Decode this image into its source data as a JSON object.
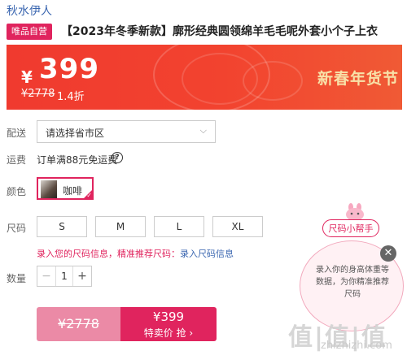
{
  "store_name": "秋水伊人",
  "badge": "唯品自营",
  "product_title": "【2023年冬季新款】廓形经典圆领绵羊毛毛呢外套小个子上衣",
  "banner": {
    "currency": "¥",
    "price": "399",
    "original_price": "¥2778",
    "discount": "1.4折",
    "promo_text": "新春年货节",
    "gradient_colors": [
      "#f03a2f",
      "#f05a35"
    ],
    "promo_color": "#f8e1a8"
  },
  "delivery": {
    "label": "配送",
    "value": "请选择省市区",
    "icon": "chevron-down-icon"
  },
  "shipping": {
    "label": "运费",
    "value": "订单满88元免运费",
    "icon": "question-icon"
  },
  "color": {
    "label": "颜色",
    "selected": "咖啡"
  },
  "size": {
    "label": "尺码",
    "options": [
      "S",
      "M",
      "L",
      "XL"
    ]
  },
  "size_entry": {
    "prompt": "录入您的尺码信息，精准推荐尺码：",
    "link": "录入尺码信息"
  },
  "quantity": {
    "label": "数量",
    "value": "1",
    "minus": "−",
    "plus": "+"
  },
  "buy": {
    "old_price": "¥2778",
    "price": "¥399",
    "action": "特卖价 抢 ›"
  },
  "size_helper": {
    "tag": "尺码小帮手",
    "bubble_text": "录入你的身高体重等数据，为你精准推荐尺码",
    "close": "✕"
  },
  "watermark": {
    "big": "值|值|值",
    "small": "zhizhizhi.com"
  },
  "accent_color": "#e0245e",
  "link_color": "#3a66b0"
}
